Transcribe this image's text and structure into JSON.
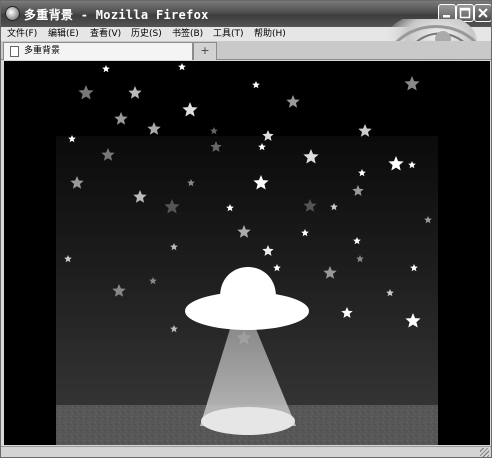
{
  "window": {
    "title": "多重背景 - Mozilla Firefox"
  },
  "menubar": {
    "items": [
      {
        "label": "文件(F)"
      },
      {
        "label": "编辑(E)"
      },
      {
        "label": "查看(V)"
      },
      {
        "label": "历史(S)"
      },
      {
        "label": "书签(B)"
      },
      {
        "label": "工具(T)"
      },
      {
        "label": "帮助(H)"
      }
    ]
  },
  "tabs": [
    {
      "label": "多重背景"
    }
  ],
  "new_tab_label": "+",
  "colors": {
    "page_background": "#000000",
    "sky_top": "#000000",
    "sky_bottom": "#3a3a3a",
    "ground": "#5a5a5a",
    "ufo": "#ffffff",
    "beam": "#a0a0a0",
    "star_bright": "#ffffff",
    "star_dim": "#888888"
  },
  "icons": {
    "app": "firefox-icon",
    "page": "page-icon",
    "minimize": "minimize-icon",
    "maximize": "maximize-icon",
    "close": "close-icon",
    "resize": "resize-grip-icon"
  }
}
